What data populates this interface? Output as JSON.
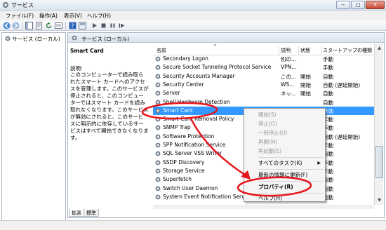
{
  "window": {
    "title": "サービス"
  },
  "menu": [
    "ファイル(F)",
    "操作(A)",
    "表示(V)",
    "ヘルプ(H)"
  ],
  "window_buttons": {
    "min": "−",
    "max": "□",
    "close": "✕"
  },
  "tree": {
    "root": "サービス (ローカル)"
  },
  "header": {
    "title": "サービス (ローカル)"
  },
  "description": {
    "name": "Smart Card",
    "label": "説明:",
    "text": "このコンピューターで読み取られたスマート カードへのアクセスを管理します。このサービスが停止されると、このコンピューターではスマート カードを読み取れなくなります。このサービスが無効にされると、このサービスに明示的に依存しているサービスはすべて開始できなくなります。"
  },
  "columns": [
    "名前",
    "説明",
    "状態",
    "スタートアップの種類"
  ],
  "services": [
    {
      "name": "Secondary Logon",
      "desc": "別の...",
      "status": "",
      "startup": "手動"
    },
    {
      "name": "Secure Socket Tunneling Protocol Service",
      "desc": "VPN...",
      "status": "",
      "startup": "手動"
    },
    {
      "name": "Security Accounts Manager",
      "desc": "この...",
      "status": "開始",
      "startup": "自動"
    },
    {
      "name": "Security Center",
      "desc": "WS...",
      "status": "開始",
      "startup": "自動 (遅延開始)"
    },
    {
      "name": "Server",
      "desc": "ネッ...",
      "status": "開始",
      "startup": "自動"
    },
    {
      "name": "Shell Hardware Detection",
      "desc": "",
      "status": "",
      "startup": "自動"
    },
    {
      "name": "Smart Card",
      "desc": "",
      "status": "",
      "startup": "無効"
    },
    {
      "name": "Smart Card Removal Policy",
      "desc": "",
      "status": "",
      "startup": "手動"
    },
    {
      "name": "SNMP Trap",
      "desc": "",
      "status": "",
      "startup": "手動"
    },
    {
      "name": "Software Protection",
      "desc": "",
      "status": "",
      "startup": "自動 (遅延開始)"
    },
    {
      "name": "SPP Notification Service",
      "desc": "",
      "status": "",
      "startup": "手動"
    },
    {
      "name": "SQL Server VSS Writer",
      "desc": "",
      "status": "",
      "startup": "自動"
    },
    {
      "name": "SSDP Discovery",
      "desc": "",
      "status": "",
      "startup": "手動"
    },
    {
      "name": "Storage Service",
      "desc": "",
      "status": "",
      "startup": "手動"
    },
    {
      "name": "Superfetch",
      "desc": "",
      "status": "",
      "startup": "自動"
    },
    {
      "name": "Switch User Daemon",
      "desc": "",
      "status": "",
      "startup": "自動"
    },
    {
      "name": "System Event Notification Service",
      "desc": "",
      "status": "",
      "startup": "自動"
    }
  ],
  "selected_index": 6,
  "context_menu": {
    "items": [
      {
        "label": "開始(S)",
        "disabled": true
      },
      {
        "label": "停止(O)",
        "disabled": true
      },
      {
        "label": "一時停止(U)",
        "disabled": true
      },
      {
        "label": "再開(M)",
        "disabled": true
      },
      {
        "label": "再起動(E)",
        "disabled": true
      },
      {
        "label": "すべてのタスク(K)",
        "disabled": false,
        "submenu": "▶"
      },
      {
        "label": "最新の情報に更新(F)",
        "disabled": false
      },
      {
        "label": "プロパティ(R)",
        "disabled": false,
        "bold": true
      },
      {
        "label": "ヘルプ(H)",
        "disabled": false
      }
    ]
  },
  "tabs": [
    "拡張",
    "標準"
  ],
  "colors": {
    "selection": "#3399ff",
    "annotation": "#e8141b"
  }
}
